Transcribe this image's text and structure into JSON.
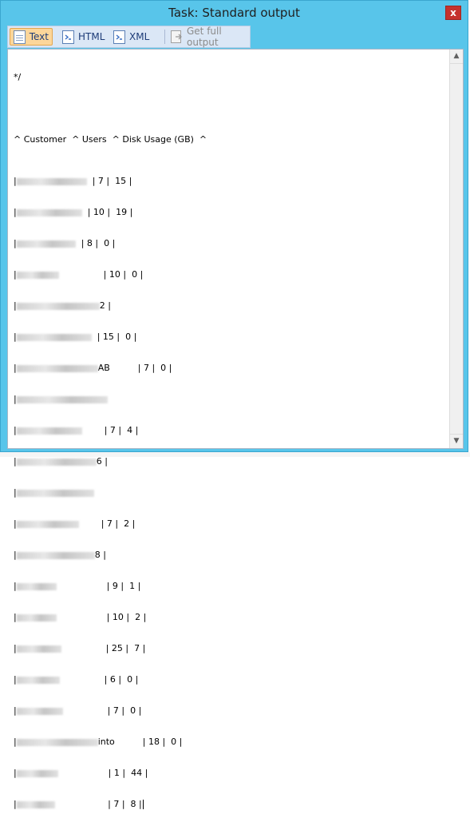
{
  "window": {
    "title": "Task: Standard output",
    "close_label": "x"
  },
  "toolbar": {
    "text_label": "Text",
    "html_label": "HTML",
    "xml_label": "XML",
    "full_output_label": "Get full output"
  },
  "output": {
    "first_line": "*/",
    "header": "^ Customer  ^ Users  ^ Disk Usage (GB)  ^",
    "rows": [
      "| 7 |  15 |",
      "| 10 |  19 |",
      "| 8 |  0 |",
      "| 10 |  0 |",
      "2 |",
      "| 15 |  0 |",
      "AB          | 7 |  0 |",
      "",
      "| 7 |  4 |",
      "6 |",
      "",
      "| 7 |  2 |",
      "8 |",
      "| 9 |  1 |",
      "| 10 |  2 |",
      "| 25 |  7 |",
      "| 6 |  0 |",
      "| 7 |  0 |",
      "into          | 18 |  0 |",
      "| 1 |  44 |",
      "| 7 |  8 |"
    ]
  }
}
